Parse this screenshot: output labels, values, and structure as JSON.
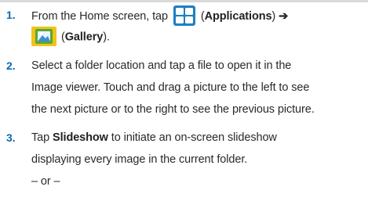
{
  "steps": [
    {
      "number": "1.",
      "line1_pre": "From the Home screen, tap",
      "line1_post_open": "(",
      "apps_label": "Applications",
      "line1_post_close": ")",
      "arrow": "➔",
      "gallery_open": "(",
      "gallery_label": "Gallery",
      "gallery_close": ").",
      "icons": [
        "applications-icon",
        "gallery-icon"
      ]
    },
    {
      "number": "2.",
      "lines": [
        "Select a folder location and tap a file to open it in the",
        "Image viewer. Touch and drag a picture to the left to see",
        "the next picture or to the right to see the previous picture."
      ]
    },
    {
      "number": "3.",
      "line1_pre": "Tap",
      "slideshow_label": "Slideshow",
      "line1_post": "to initiate an on-screen slideshow",
      "line2": "displaying every image in the current folder.",
      "or_line": "– or –"
    }
  ],
  "colors": {
    "step_number": "#0a6ab4",
    "apps_icon_bg": "#1e7fc4",
    "gallery_icon_bg": "#f2c21a",
    "gallery_icon_frame": "#59a832"
  }
}
